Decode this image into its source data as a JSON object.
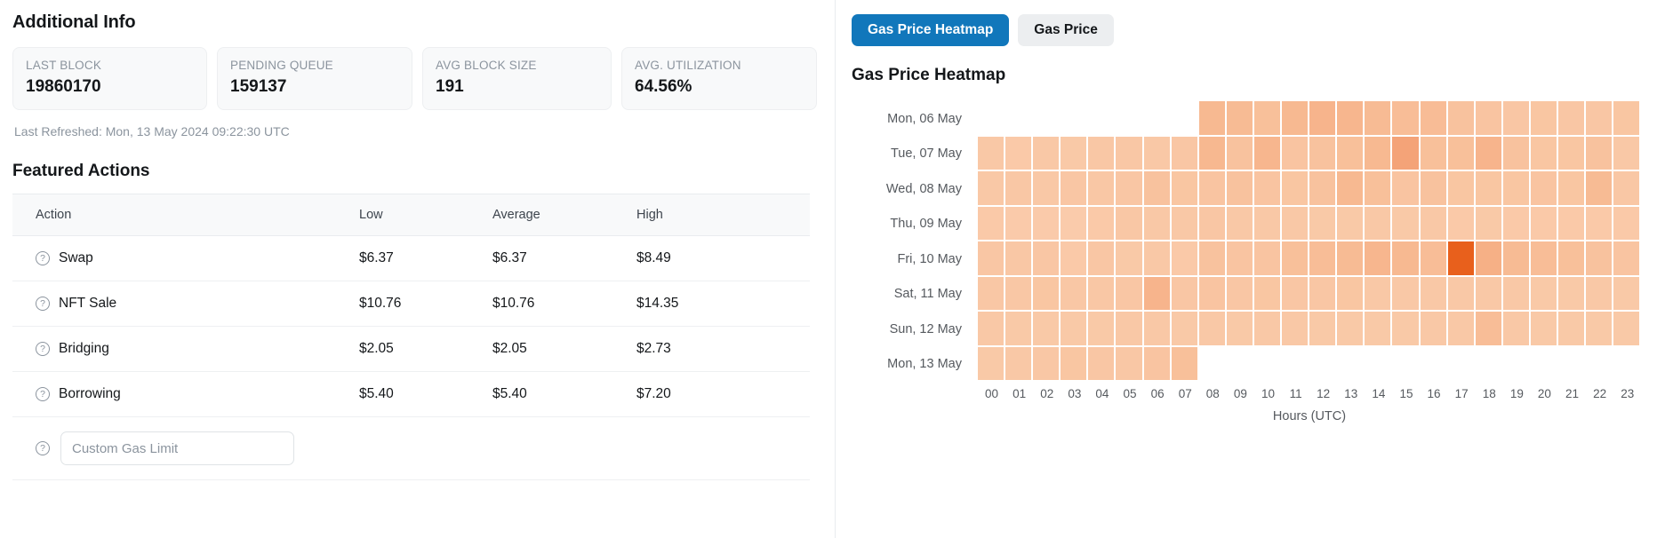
{
  "left": {
    "additional_info_title": "Additional Info",
    "stats": [
      {
        "label": "LAST BLOCK",
        "value": "19860170"
      },
      {
        "label": "PENDING QUEUE",
        "value": "159137"
      },
      {
        "label": "AVG BLOCK SIZE",
        "value": "191"
      },
      {
        "label": "AVG. UTILIZATION",
        "value": "64.56%"
      }
    ],
    "last_refreshed": "Last Refreshed: Mon, 13 May 2024 09:22:30 UTC",
    "featured_actions_title": "Featured Actions",
    "table": {
      "headers": [
        "Action",
        "Low",
        "Average",
        "High"
      ],
      "rows": [
        {
          "icon": "help-circle-icon",
          "action": "Swap",
          "low": "$6.37",
          "average": "$6.37",
          "high": "$8.49"
        },
        {
          "icon": "help-circle-icon",
          "action": "NFT Sale",
          "low": "$10.76",
          "average": "$10.76",
          "high": "$14.35"
        },
        {
          "icon": "help-circle-icon",
          "action": "Bridging",
          "low": "$2.05",
          "average": "$2.05",
          "high": "$2.73"
        },
        {
          "icon": "help-circle-icon",
          "action": "Borrowing",
          "low": "$5.40",
          "average": "$5.40",
          "high": "$7.20"
        }
      ],
      "custom_row": {
        "icon": "help-circle-icon",
        "input_placeholder": "Custom Gas Limit",
        "input_value": ""
      }
    },
    "help_glyph": "?"
  },
  "right": {
    "tabs": [
      {
        "label": "Gas Price Heatmap",
        "active": true
      },
      {
        "label": "Gas Price",
        "active": false
      }
    ],
    "chart_title": "Gas Price Heatmap",
    "accent_color": "#1177bb",
    "tab_inactive_color": "#eceef0"
  },
  "chart_data": {
    "type": "heatmap",
    "title": "Gas Price Heatmap",
    "xlabel": "Hours (UTC)",
    "ylabel": "",
    "x": [
      "00",
      "01",
      "02",
      "03",
      "04",
      "05",
      "06",
      "07",
      "08",
      "09",
      "10",
      "11",
      "12",
      "13",
      "14",
      "15",
      "16",
      "17",
      "18",
      "19",
      "20",
      "21",
      "22",
      "23"
    ],
    "y": [
      "Mon, 06 May",
      "Tue, 07 May",
      "Wed, 08 May",
      "Thu, 09 May",
      "Fri, 10 May",
      "Sat, 11 May",
      "Sun, 12 May",
      "Mon, 13 May"
    ],
    "colorscale": [
      "#fde5d4",
      "#fcdcc6",
      "#fbd2b7",
      "#f9c6a3",
      "#f6b086",
      "#f19468",
      "#e8601c"
    ],
    "vmin": 0,
    "vmax": 100,
    "note": "null = no data (cell not drawn)",
    "values": [
      [
        null,
        null,
        null,
        null,
        null,
        null,
        null,
        null,
        44,
        42,
        38,
        44,
        48,
        46,
        42,
        40,
        41,
        36,
        34,
        32,
        33,
        32,
        32,
        33
      ],
      [
        30,
        28,
        30,
        29,
        31,
        31,
        30,
        32,
        45,
        36,
        46,
        34,
        36,
        38,
        44,
        62,
        38,
        38,
        48,
        36,
        33,
        33,
        36,
        30
      ],
      [
        30,
        31,
        30,
        32,
        31,
        32,
        36,
        33,
        34,
        36,
        34,
        33,
        36,
        44,
        38,
        34,
        36,
        33,
        33,
        33,
        34,
        33,
        42,
        31
      ],
      [
        28,
        27,
        27,
        26,
        28,
        31,
        30,
        30,
        32,
        30,
        30,
        30,
        29,
        29,
        30,
        29,
        30,
        28,
        29,
        28,
        28,
        28,
        28,
        28
      ],
      [
        32,
        31,
        32,
        28,
        32,
        29,
        30,
        28,
        36,
        34,
        34,
        38,
        40,
        42,
        46,
        44,
        40,
        100,
        52,
        42,
        40,
        38,
        36,
        34
      ],
      [
        31,
        31,
        33,
        31,
        31,
        32,
        48,
        32,
        34,
        32,
        33,
        32,
        32,
        33,
        30,
        30,
        30,
        30,
        30,
        30,
        29,
        29,
        30,
        29
      ],
      [
        30,
        29,
        29,
        29,
        29,
        30,
        30,
        29,
        30,
        29,
        30,
        30,
        29,
        29,
        29,
        29,
        30,
        30,
        40,
        30,
        29,
        29,
        29,
        29
      ],
      [
        29,
        30,
        31,
        33,
        32,
        31,
        34,
        38,
        null,
        null,
        null,
        null,
        null,
        null,
        null,
        null,
        null,
        null,
        null,
        null,
        null,
        null,
        null,
        null
      ]
    ]
  }
}
